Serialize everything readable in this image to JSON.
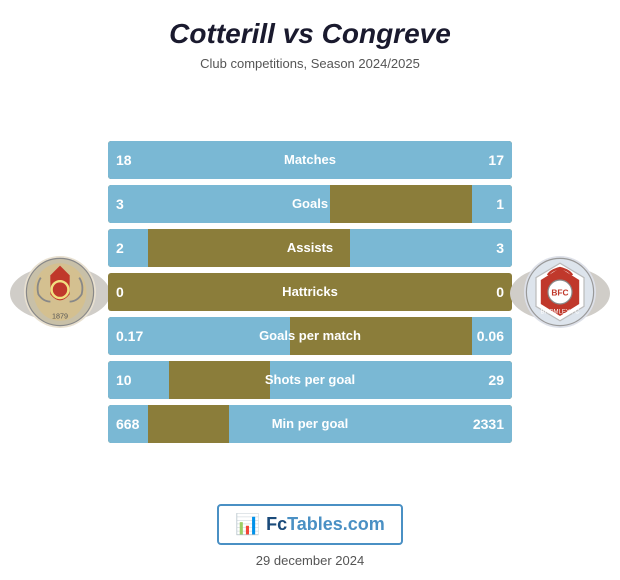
{
  "title": "Cotterill vs Congreve",
  "subtitle": "Club competitions, Season 2024/2025",
  "stats": [
    {
      "label": "Matches",
      "left_val": "18",
      "right_val": "17",
      "left_pct": 51,
      "right_pct": 49
    },
    {
      "label": "Goals",
      "left_val": "3",
      "right_val": "1",
      "left_pct": 55,
      "right_pct": 10
    },
    {
      "label": "Assists",
      "left_val": "2",
      "right_val": "3",
      "left_pct": 10,
      "right_pct": 40
    },
    {
      "label": "Hattricks",
      "left_val": "0",
      "right_val": "0",
      "left_pct": 0,
      "right_pct": 0
    },
    {
      "label": "Goals per match",
      "left_val": "0.17",
      "right_val": "0.06",
      "left_pct": 45,
      "right_pct": 10
    },
    {
      "label": "Shots per goal",
      "left_val": "10",
      "right_val": "29",
      "left_pct": 15,
      "right_pct": 60
    },
    {
      "label": "Min per goal",
      "left_val": "668",
      "right_val": "2331",
      "left_pct": 10,
      "right_pct": 70
    }
  ],
  "logo": {
    "text_dark": "Fc",
    "text_light": "Tables.com",
    "icon": "📊"
  },
  "footer_date": "29 december 2024"
}
